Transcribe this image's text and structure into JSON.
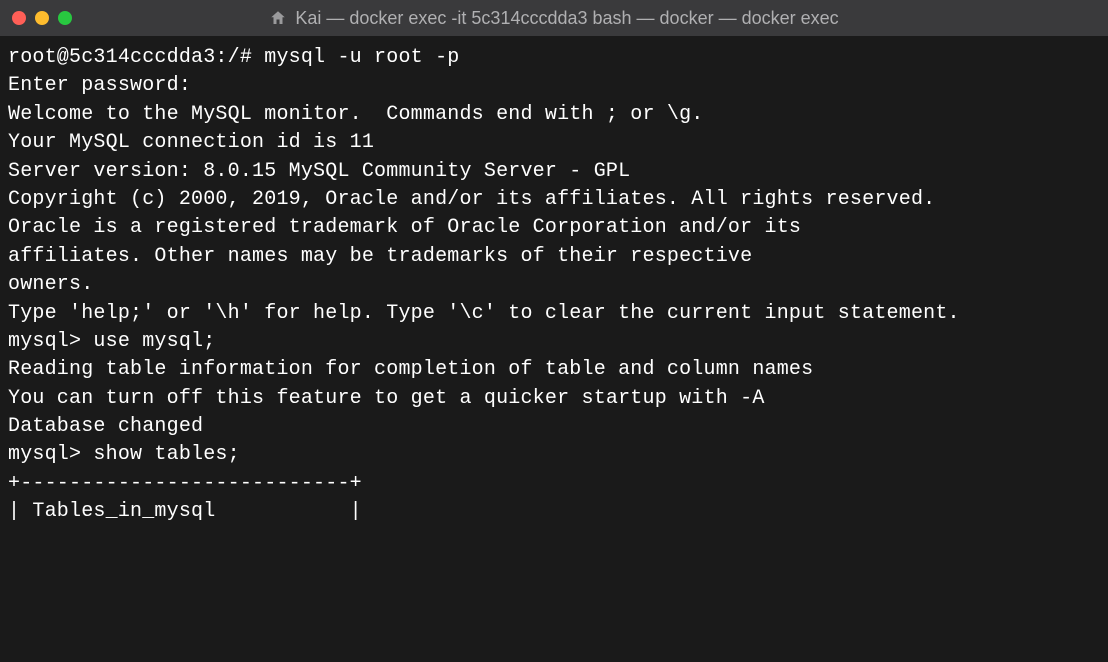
{
  "window": {
    "title": "Kai — docker exec -it 5c314cccdda3 bash — docker — docker exec"
  },
  "terminal": {
    "lines": [
      "root@5c314cccdda3:/# mysql -u root -p",
      "Enter password:",
      "Welcome to the MySQL monitor.  Commands end with ; or \\g.",
      "Your MySQL connection id is 11",
      "Server version: 8.0.15 MySQL Community Server - GPL",
      "",
      "Copyright (c) 2000, 2019, Oracle and/or its affiliates. All rights reserved.",
      "",
      "Oracle is a registered trademark of Oracle Corporation and/or its",
      "affiliates. Other names may be trademarks of their respective",
      "owners.",
      "",
      "Type 'help;' or '\\h' for help. Type '\\c' to clear the current input statement.",
      "",
      "mysql> use mysql;",
      "Reading table information for completion of table and column names",
      "You can turn off this feature to get a quicker startup with -A",
      "",
      "Database changed",
      "mysql> show tables;",
      "+---------------------------+",
      "| Tables_in_mysql           |"
    ]
  }
}
